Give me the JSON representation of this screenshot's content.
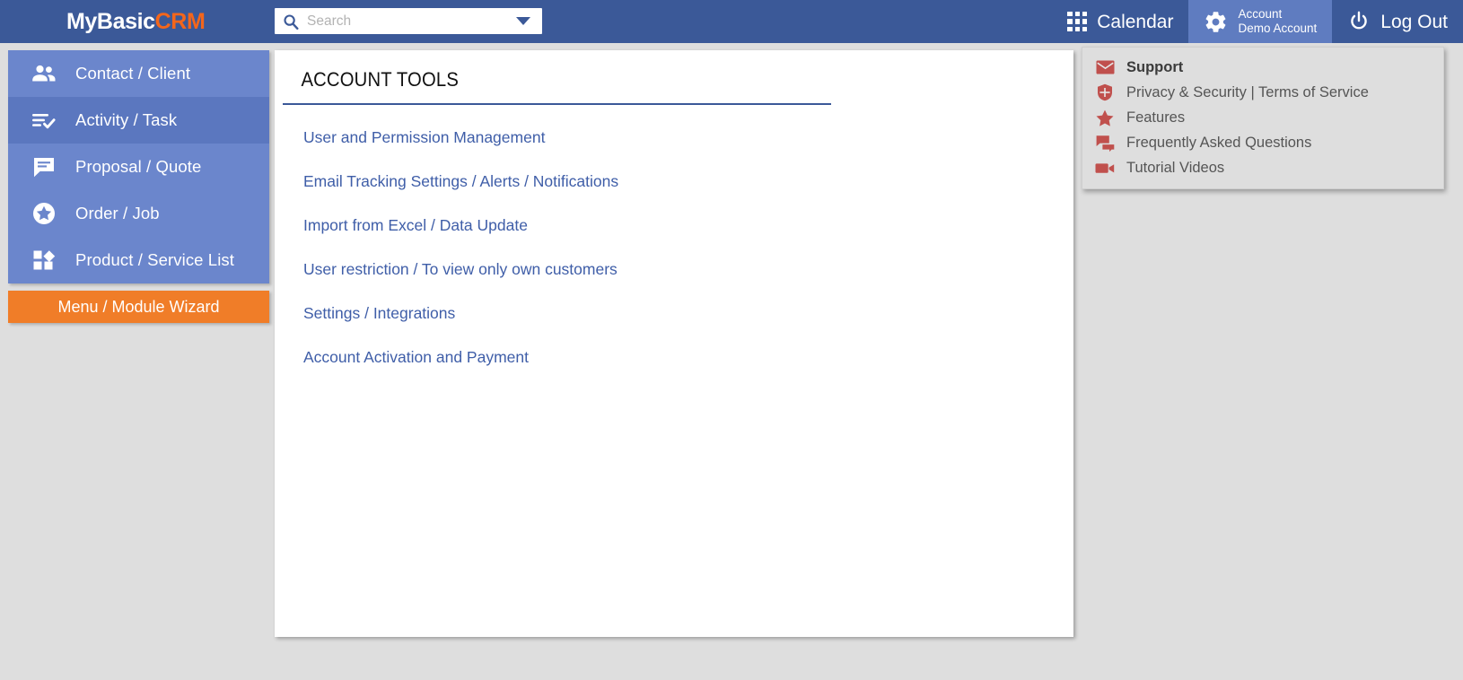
{
  "brand": {
    "part1": "MyBasic",
    "part2": "CRM"
  },
  "search": {
    "placeholder": "Search",
    "value": "",
    "icon": "search-icon",
    "caret_icon": "chevron-down-icon"
  },
  "header": {
    "calendar": {
      "label": "Calendar",
      "icon": "grid-icon"
    },
    "account": {
      "line1": "Account",
      "line2": "Demo Account",
      "icon": "gear-icon"
    },
    "logout": {
      "label": "Log Out",
      "icon": "power-icon"
    }
  },
  "sidebar": {
    "items": [
      {
        "label": "Contact / Client",
        "icon": "people-icon",
        "active": false
      },
      {
        "label": "Activity / Task",
        "icon": "task-list-check-icon",
        "active": true
      },
      {
        "label": "Proposal / Quote",
        "icon": "chat-lines-icon",
        "active": false
      },
      {
        "label": "Order / Job",
        "icon": "star-circle-icon",
        "active": false
      },
      {
        "label": "Product / Service List",
        "icon": "shapes-icon",
        "active": false
      }
    ],
    "wizard_button": "Menu / Module Wizard"
  },
  "main": {
    "title": "ACCOUNT TOOLS",
    "links": [
      "User and Permission Management",
      "Email Tracking Settings / Alerts / Notifications",
      "Import from Excel / Data Update",
      "User restriction / To view only own customers",
      "Settings / Integrations",
      "Account Activation and Payment"
    ]
  },
  "account_menu": {
    "items": [
      {
        "label": "Support",
        "icon": "envelope-icon",
        "bold": true
      },
      {
        "label": "Privacy & Security | Terms of Service",
        "icon": "shield-icon",
        "bold": false
      },
      {
        "label": "Features",
        "icon": "star-icon",
        "bold": false
      },
      {
        "label": "Frequently Asked Questions",
        "icon": "chat-bubbles-icon",
        "bold": false
      },
      {
        "label": "Tutorial Videos",
        "icon": "video-camera-icon",
        "bold": false
      }
    ]
  },
  "colors": {
    "header_blue": "#3b5998",
    "sidebar_blue": "#6b86cc",
    "sidebar_active": "#5b77bf",
    "accent_orange": "#f07d28",
    "link_blue": "#3f5ea8",
    "menu_icon_red": "#c0504d",
    "page_bg": "#dedede"
  }
}
